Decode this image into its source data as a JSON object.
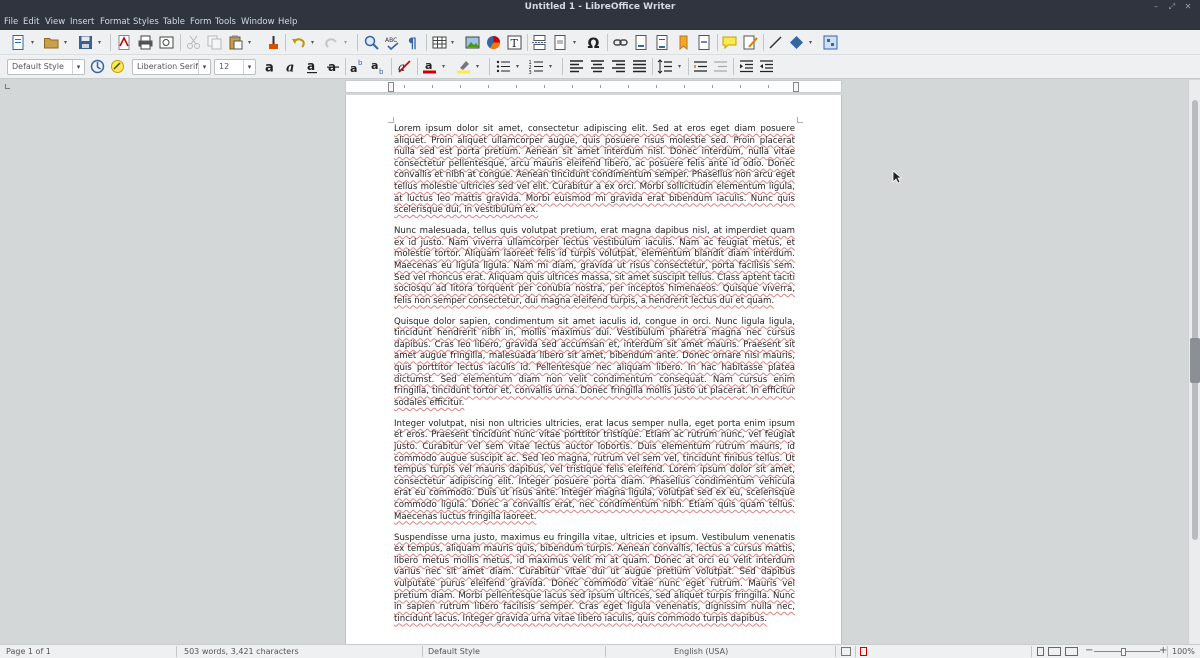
{
  "window": {
    "title": "Untitled 1 - LibreOffice Writer",
    "minimize": "–",
    "restore": "⤢",
    "close": "✕"
  },
  "menu": [
    "File",
    "Edit",
    "View",
    "Insert",
    "Format",
    "Styles",
    "Table",
    "Form",
    "Tools",
    "Window",
    "Help"
  ],
  "formatting": {
    "paragraph_style": "Default Style",
    "font_name": "Liberation Serif",
    "font_size": "12"
  },
  "document": {
    "paragraphs": [
      "Lorem ipsum dolor sit amet, consectetur adipiscing elit. Sed at eros eget diam posuere aliquet. Proin aliquet ullamcorper augue, quis posuere risus molestie sed. Proin placerat nulla sed est porta pretium. Aenean sit amet interdum nisl. Donec interdum, nulla vitae consectetur pellentesque, arcu mauris eleifend libero, ac posuere felis ante id odio. Donec convallis et nibh at congue. Aenean tincidunt condimentum semper. Phasellus non arcu eget tellus molestie ultricies sed vel elit. Curabitur a ex orci. Morbi sollicitudin elementum ligula, at luctus leo mattis gravida. Morbi euismod mi gravida erat bibendum iaculis. Nunc quis scelerisque dui, in vestibulum ex.",
      "Nunc malesuada, tellus quis volutpat pretium, erat magna dapibus nisl, at imperdiet quam ex id justo. Nam viverra ullamcorper lectus vestibulum iaculis. Nam ac feugiat metus, et molestie tortor. Aliquam laoreet felis id turpis volutpat, elementum blandit diam interdum. Maecenas eu ligula ligula. Nam mi diam, gravida ut risus consectetur, porta facilisis sem. Sed vel rhoncus erat. Aliquam quis ultrices massa, sit amet suscipit tellus. Class aptent taciti sociosqu ad litora torquent per conubia nostra, per inceptos himenaeos. Quisque viverra, felis non semper consectetur, dui magna eleifend turpis, a hendrerit lectus dui et quam.",
      "Quisque dolor sapien, condimentum sit amet iaculis id, congue in orci. Nunc ligula ligula, tincidunt hendrerit nibh in, mollis maximus dui. Vestibulum pharetra magna nec cursus dapibus. Cras leo libero, gravida sed accumsan et, interdum sit amet mauris. Praesent sit amet augue fringilla, malesuada libero sit amet, bibendum ante. Donec ornare nisi mauris, quis porttitor lectus iaculis id. Pellentesque nec aliquam libero. In hac habitasse platea dictumst. Sed elementum diam non velit condimentum consequat. Nam cursus enim fringilla, tincidunt tortor et, convallis urna. Donec fringilla mollis justo ut placerat. In efficitur sodales efficitur.",
      "Integer volutpat, nisi non ultricies ultricies, erat lacus semper nulla, eget porta enim ipsum et eros. Praesent tincidunt nunc vitae porttitor tristique. Etiam ac rutrum nunc, vel feugiat justo. Curabitur vel sem vitae lectus auctor lobortis. Duis elementum rutrum mauris, id commodo augue suscipit ac. Sed leo magna, rutrum vel sem vel, tincidunt finibus tellus. Ut tempus turpis vel mauris dapibus, vel tristique felis eleifend. Lorem ipsum dolor sit amet, consectetur adipiscing elit. Integer posuere porta diam. Phasellus condimentum vehicula erat eu commodo. Duis ut risus ante. Integer magna ligula, volutpat sed ex eu, scelerisque commodo ligula. Donec a convallis erat, nec condimentum nibh. Etiam quis quam tellus. Maecenas luctus fringilla laoreet.",
      "Suspendisse urna justo, maximus eu fringilla vitae, ultricies et ipsum. Vestibulum venenatis ex tempus, aliquam mauris quis, bibendum turpis. Aenean convallis, lectus a cursus mattis, libero metus mollis metus, id maximus velit mi at quam. Donec at orci eu velit interdum varius nec sit amet diam. Curabitur vitae dui ut augue pretium volutpat. Sed dapibus vulputate purus eleifend gravida. Donec commodo vitae nunc eget rutrum. Mauris vel pretium diam. Morbi pellentesque lacus sed ipsum ultrices, sed aliquet turpis fringilla. Nunc in sapien rutrum libero facilisis semper. Cras eget ligula venenatis, dignissim nulla nec, tincidunt lacus. Integer gravida urna vitae libero iaculis, quis commodo turpis dapibus."
    ]
  },
  "status": {
    "page": "Page 1 of 1",
    "words": "503 words, 3,421 characters",
    "page_style": "Default Style",
    "language": "English (USA)",
    "zoom": "100%",
    "zoom_minus": "−",
    "zoom_plus": "+"
  },
  "colors": {
    "titlebar": "#2f343f",
    "toolbar": "#eef0f1",
    "workspace": "#d4d7d8",
    "spellcheck": "#e08080"
  }
}
